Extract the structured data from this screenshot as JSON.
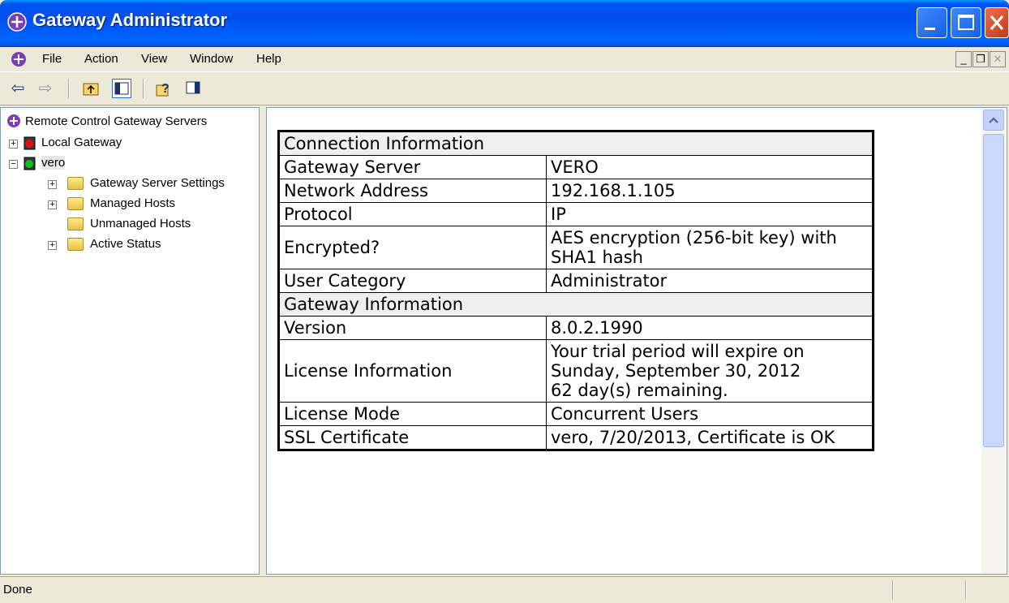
{
  "window": {
    "title": "Gateway Administrator"
  },
  "menu": [
    "File",
    "Action",
    "View",
    "Window",
    "Help"
  ],
  "toolbar": {
    "icons": [
      "back-arrow-icon",
      "forward-arrow-icon",
      "up-one-level-icon",
      "show-hide-console-tree-icon",
      "help-icon",
      "show-hide-action-pane-icon"
    ]
  },
  "tree": {
    "root": "Remote Control Gateway Servers",
    "local_gateway": "Local Gateway",
    "vero": "vero",
    "children": [
      "Gateway Server Settings",
      "Managed Hosts",
      "Unmanaged Hosts",
      "Active Status"
    ]
  },
  "info": {
    "connection_header": "Connection Information",
    "gateway_header": "Gateway Information",
    "rows": {
      "gateway_server": {
        "label": "Gateway Server",
        "value": "VERO"
      },
      "network_address": {
        "label": "Network Address",
        "value": "192.168.1.105"
      },
      "protocol": {
        "label": "Protocol",
        "value": "IP"
      },
      "encrypted": {
        "label": "Encrypted?",
        "value": "AES encryption (256-bit key) with SHA1 hash"
      },
      "user_category": {
        "label": "User Category",
        "value": "Administrator"
      },
      "version": {
        "label": "Version",
        "value": "8.0.2.1990"
      },
      "license_information": {
        "label": "License Information",
        "value1": "Your trial period will expire on",
        "value2": "Sunday, September 30, 2012",
        "value3": "62 day(s) remaining."
      },
      "license_mode": {
        "label": "License Mode",
        "value": "Concurrent Users"
      },
      "ssl_certificate": {
        "label": "SSL Certificate",
        "value": "vero, 7/20/2013, Certificate is OK"
      }
    }
  },
  "status": {
    "text": "Done"
  },
  "colors": {
    "titlebar": "#0053ee",
    "close_button": "#c5391a",
    "chrome": "#ece9d8"
  }
}
